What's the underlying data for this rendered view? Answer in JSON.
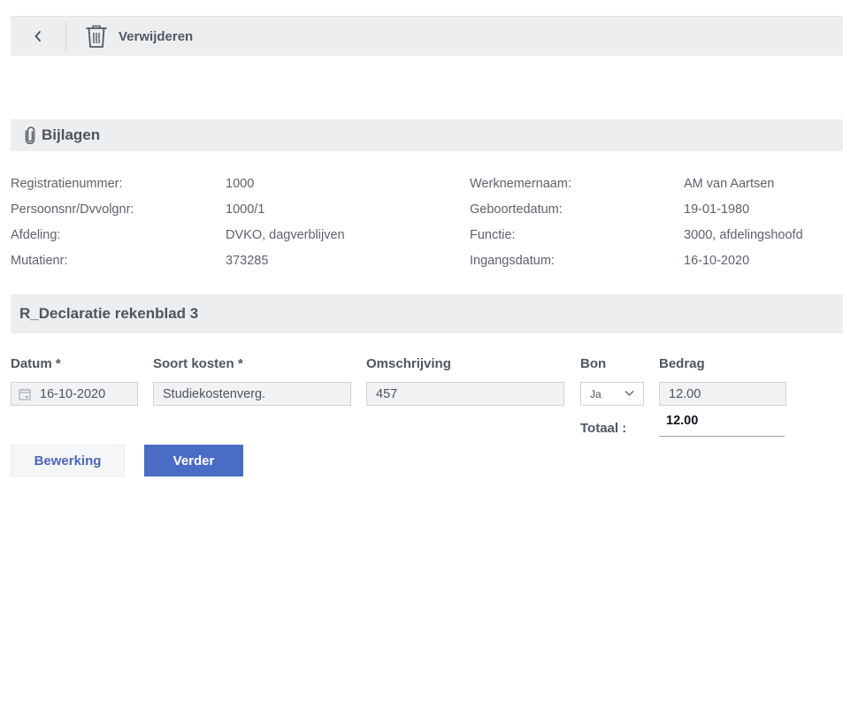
{
  "toolbar": {
    "back_icon": "chevron-left-icon",
    "delete_icon": "trash-icon",
    "delete_label": "Verwijderen"
  },
  "attachments": {
    "icon": "paperclip-icon",
    "title": "Bijlagen"
  },
  "details": {
    "left": [
      {
        "label": "Registratienummer:",
        "value": "1000"
      },
      {
        "label": "Persoonsnr/Dvvolgnr:",
        "value": "1000/1"
      },
      {
        "label": "Afdeling:",
        "value": "DVKO, dagverblijven"
      },
      {
        "label": "Mutatienr:",
        "value": "373285"
      }
    ],
    "right": [
      {
        "label": "Werknemernaam:",
        "value": "AM van Aartsen"
      },
      {
        "label": "Geboortedatum:",
        "value": "19-01-1980"
      },
      {
        "label": "Functie:",
        "value": "3000, afdelingshoofd"
      },
      {
        "label": "Ingangsdatum:",
        "value": "16-10-2020"
      }
    ]
  },
  "sheet": {
    "title": "R_Declaratie rekenblad 3",
    "columns": {
      "date": "Datum *",
      "kind": "Soort kosten *",
      "description": "Omschrijving",
      "receipt": "Bon",
      "amount": "Bedrag"
    },
    "row": {
      "date": "16-10-2020",
      "kind": "Studiekostenverg.",
      "description": "457",
      "receipt": "Ja",
      "amount": "12.00"
    },
    "total_label": "Totaal :",
    "total_value": "12.00"
  },
  "actions": {
    "edit_label": "Bewerking",
    "next_label": "Verder"
  },
  "colors": {
    "accent": "#4a6cc5",
    "bar_background": "#eceef0"
  }
}
